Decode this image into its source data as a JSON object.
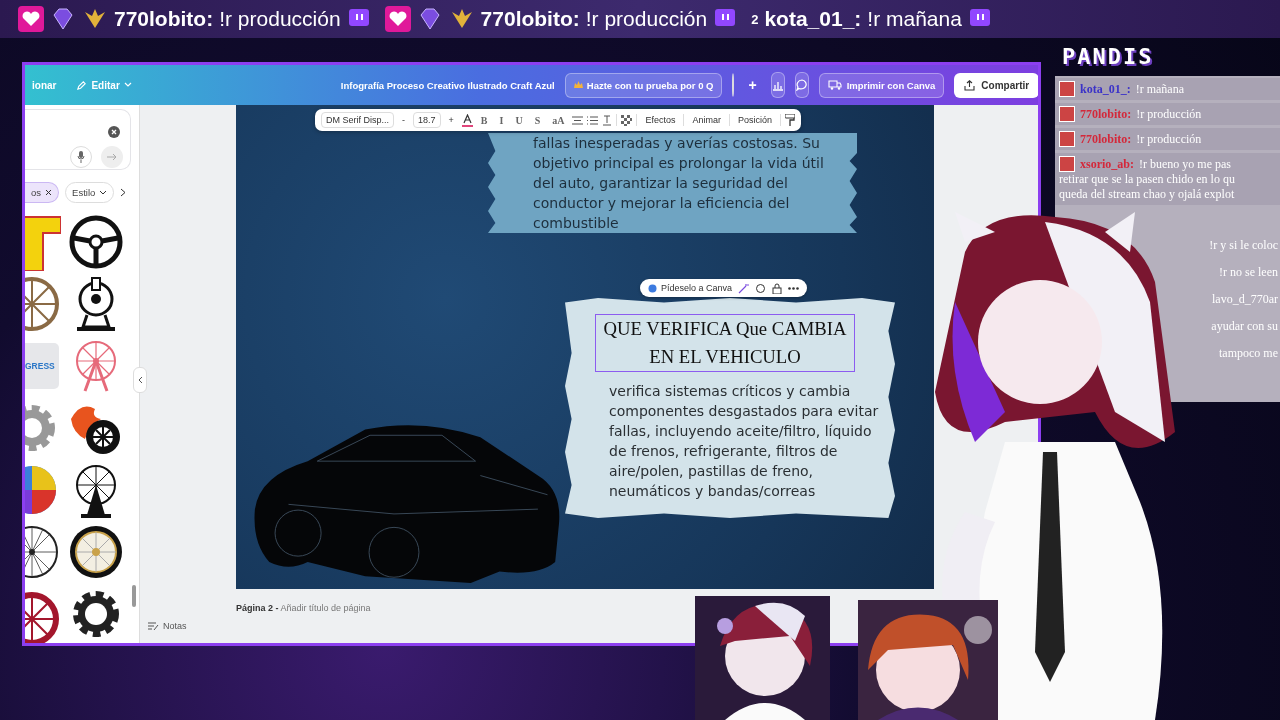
{
  "ticker": [
    {
      "user": "770lobito:",
      "message": "!r producción"
    },
    {
      "user": "770lobito:",
      "message": "!r producción"
    },
    {
      "user": "kota_01_:",
      "message": "!r mañana",
      "count": "2"
    }
  ],
  "editor": {
    "header": {
      "menu_fragment": "ionar",
      "edit_menu": "Editar",
      "title": "Infografía Proceso Creativo Ilustrado Craft Azul",
      "trial_button": "Hazte con tu prueba por 0 Q",
      "add_button": "+",
      "print_button": "Imprimir con Canva",
      "share_button": "Compartir"
    },
    "side_panel": {
      "chips": [
        {
          "label": "os",
          "removable": true
        },
        {
          "label": "Estilo",
          "removable": false
        }
      ],
      "thumbnail_text": "GRESS"
    },
    "text_toolbar": {
      "font": "DM Serif Disp...",
      "decrease": "-",
      "size": "18.7",
      "increase": "+",
      "format_buttons": [
        "B",
        "I",
        "U",
        "S",
        "aA"
      ],
      "menu_buttons": [
        "Efectos",
        "Animar",
        "Posición"
      ]
    },
    "page": {
      "top_card_text": "fallas inesperadas y averías costosas. Su objetivo principal es prolongar la vida útil del auto, garantizar la seguridad del conductor y mejorar la eficiencia del combustible",
      "ai_pill": "Pídeselo a Canva",
      "heading": "QUE VERIFICA Que CAMBIA EN EL VEHICULO",
      "body": "verifica sistemas críticos y cambia componentes desgastados para evitar fallas, incluyendo aceite/filtro, líquido de frenos, refrigerante, filtros de aire/polen, pastillas de freno, neumáticos y bandas/correas"
    },
    "footer": {
      "page_label": "Página 2 -",
      "page_title_placeholder": "Añadir título de página",
      "notes": "Notas"
    }
  },
  "chat": {
    "title": "PANDIS",
    "messages": [
      {
        "user": "kota_01_:",
        "color": "#3b32c8",
        "lines": [
          "!r mañana"
        ]
      },
      {
        "user": "770lobito:",
        "color": "#d4283a",
        "lines": [
          "!r producción"
        ]
      },
      {
        "user": "770lobito:",
        "color": "#d4283a",
        "lines": [
          "!r producción"
        ]
      },
      {
        "user": "xsorio_ab:",
        "color": "#d4283a",
        "lines": [
          "!r bueno yo me pas",
          "retirar que se la pasen chido en lo qu",
          "queda del stream chao y ojalá explot"
        ]
      }
    ],
    "fragments": [
      "!r y si le coloc",
      "!r no se leen",
      "lavo_d_770ar",
      "ayudar con su",
      "tampoco me"
    ]
  }
}
